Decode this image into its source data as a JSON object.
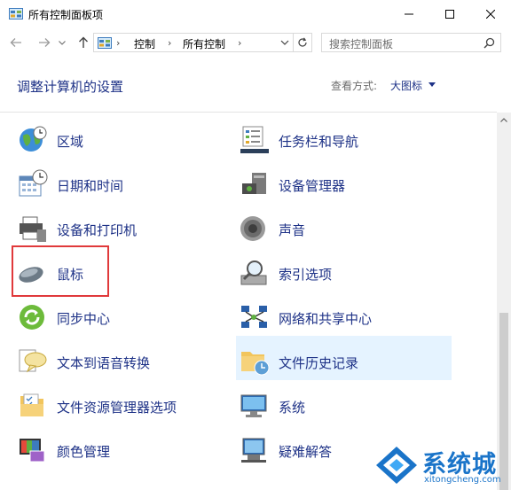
{
  "window": {
    "title": "所有控制面板项",
    "icon": "control-panel-icon"
  },
  "address": {
    "breadcrumbs": [
      "控制",
      "所有控制"
    ],
    "search_placeholder": "搜索控制面板"
  },
  "header": {
    "heading": "调整计算机的设置",
    "view_by_label": "查看方式:",
    "view_by_value": "大图标"
  },
  "items": [
    {
      "label": "区域",
      "icon": "globe-clock-icon"
    },
    {
      "label": "任务栏和导航",
      "icon": "taskbar-icon"
    },
    {
      "label": "日期和时间",
      "icon": "calendar-clock-icon"
    },
    {
      "label": "设备管理器",
      "icon": "device-manager-icon"
    },
    {
      "label": "设备和打印机",
      "icon": "printer-icon"
    },
    {
      "label": "声音",
      "icon": "speaker-icon"
    },
    {
      "label": "鼠标",
      "icon": "mouse-icon"
    },
    {
      "label": "索引选项",
      "icon": "magnifier-drive-icon"
    },
    {
      "label": "同步中心",
      "icon": "sync-icon"
    },
    {
      "label": "网络和共享中心",
      "icon": "network-icon"
    },
    {
      "label": "文本到语音转换",
      "icon": "speech-bubble-icon"
    },
    {
      "label": "文件历史记录",
      "icon": "folder-clock-icon"
    },
    {
      "label": "文件资源管理器选项",
      "icon": "folder-options-icon"
    },
    {
      "label": "系统",
      "icon": "monitor-icon"
    },
    {
      "label": "颜色管理",
      "icon": "color-management-icon"
    },
    {
      "label": "疑难解答",
      "icon": "troubleshoot-icon"
    }
  ],
  "watermark": {
    "brand": "系统城",
    "url": "xitongcheng.com"
  },
  "colors": {
    "link": "#1e3287",
    "highlight": "#e5f3ff",
    "annotation": "#e0393b"
  }
}
